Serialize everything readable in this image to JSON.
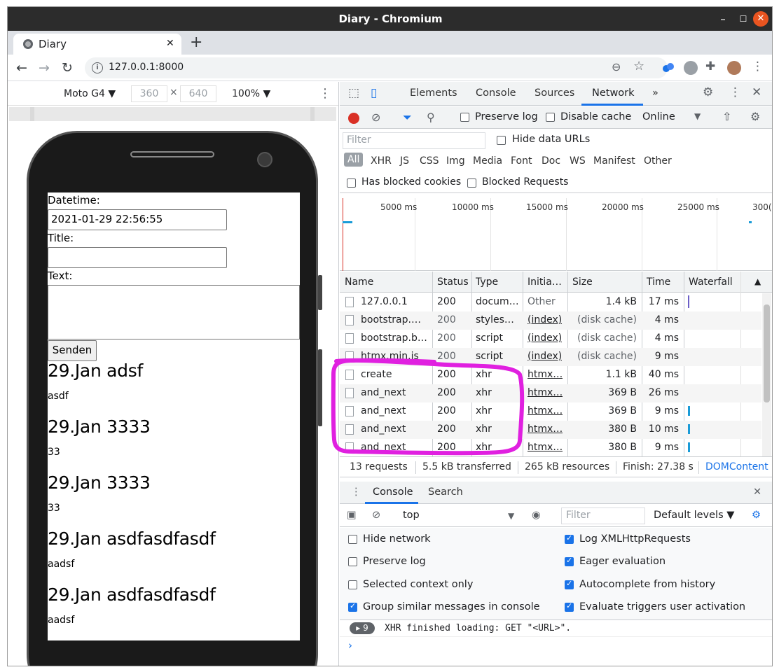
{
  "window": {
    "title": "Diary - Chromium"
  },
  "tab": {
    "label": "Diary"
  },
  "address": {
    "url": "127.0.0.1:8000"
  },
  "emulation": {
    "device": "Moto G4 ▼",
    "width": "360",
    "height": "640",
    "times": "×",
    "zoom": "100% ▼"
  },
  "diary": {
    "datetime_label": "Datetime:",
    "datetime_value": "2021-01-29 22:56:55",
    "title_label": "Title:",
    "text_label": "Text:",
    "submit": "Senden",
    "entries": [
      {
        "title": "29.Jan adsf",
        "body": "asdf"
      },
      {
        "title": "29.Jan 3333",
        "body": "33"
      },
      {
        "title": "29.Jan 3333",
        "body": "33"
      },
      {
        "title": "29.Jan asdfasdfasdf",
        "body": "aadsf"
      },
      {
        "title": "29.Jan asdfasdfasdf",
        "body": "aadsf"
      }
    ]
  },
  "devtools": {
    "tabs": [
      "Elements",
      "Console",
      "Sources",
      "Network",
      "»"
    ],
    "active_tab": "Network",
    "network": {
      "preserve_log": "Preserve log",
      "disable_cache": "Disable cache",
      "throttle": "Online",
      "filter_placeholder": "Filter",
      "hide_data_urls": "Hide data URLs",
      "types": [
        "All",
        "XHR",
        "JS",
        "CSS",
        "Img",
        "Media",
        "Font",
        "Doc",
        "WS",
        "Manifest",
        "Other"
      ],
      "has_blocked_cookies": "Has blocked cookies",
      "blocked_requests": "Blocked Requests",
      "timeline_ticks": [
        "5000 ms",
        "10000 ms",
        "15000 ms",
        "20000 ms",
        "25000 ms",
        "300("
      ],
      "columns": [
        "Name",
        "Status",
        "Type",
        "Initia…",
        "Size",
        "Time",
        "Waterfall"
      ],
      "rows": [
        {
          "name": "127.0.0.1",
          "status": "200",
          "type": "docum…",
          "initiator": "Other",
          "size": "1.4 kB",
          "time": "17 ms"
        },
        {
          "name": "bootstrap.…",
          "status": "200",
          "type": "styles…",
          "initiator": "(index)",
          "size": "(disk cache)",
          "time": "4 ms"
        },
        {
          "name": "bootstrap.b…",
          "status": "200",
          "type": "script",
          "initiator": "(index)",
          "size": "(disk cache)",
          "time": "4 ms"
        },
        {
          "name": "htmx.min.js",
          "status": "200",
          "type": "script",
          "initiator": "(index)",
          "size": "(disk cache)",
          "time": "9 ms"
        },
        {
          "name": "create",
          "status": "200",
          "type": "xhr",
          "initiator": "htmx…",
          "size": "1.1 kB",
          "time": "40 ms"
        },
        {
          "name": "and_next",
          "status": "200",
          "type": "xhr",
          "initiator": "htmx…",
          "size": "369 B",
          "time": "26 ms"
        },
        {
          "name": "and_next",
          "status": "200",
          "type": "xhr",
          "initiator": "htmx…",
          "size": "369 B",
          "time": "9 ms"
        },
        {
          "name": "and_next",
          "status": "200",
          "type": "xhr",
          "initiator": "htmx…",
          "size": "380 B",
          "time": "10 ms"
        },
        {
          "name": "and_next",
          "status": "200",
          "type": "xhr",
          "initiator": "htmx…",
          "size": "380 B",
          "time": "9 ms"
        }
      ],
      "summary": {
        "requests": "13 requests",
        "transferred": "5.5 kB transferred",
        "resources": "265 kB resources",
        "finish": "Finish: 27.38 s",
        "domcontent": "DOMContent"
      }
    },
    "drawer": {
      "tabs": [
        "Console",
        "Search"
      ],
      "context": "top",
      "filter_placeholder": "Filter",
      "levels": "Default levels ▼",
      "settings": {
        "hide_network": "Hide network",
        "preserve_log": "Preserve log",
        "selected_context": "Selected context only",
        "group_similar": "Group similar messages in console",
        "log_xhr": "Log XMLHttpRequests",
        "eager_eval": "Eager evaluation",
        "autocomplete": "Autocomplete from history",
        "evaluate_triggers": "Evaluate triggers user activation"
      },
      "message_count": "▸ 9",
      "message": "XHR finished loading: GET \"<URL>\".",
      "prompt": "›"
    }
  },
  "colors": {
    "accent": "#1a73e8",
    "annotation": "#e020e0",
    "record": "#d93025"
  }
}
